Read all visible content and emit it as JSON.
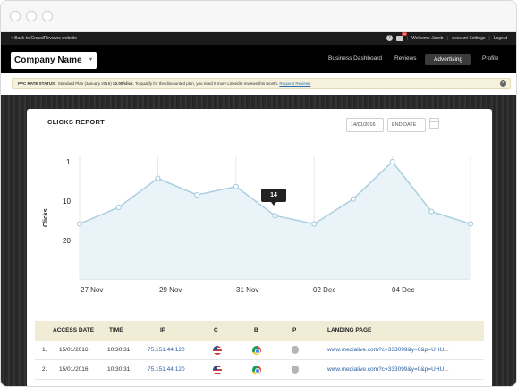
{
  "topbar": {
    "back_link": "< Back to CrowdReviews website",
    "welcome": "Welcome Jacob",
    "account_settings": "Account Settings",
    "logout": "Logout",
    "mail_badge": "10"
  },
  "header": {
    "company_name": "Company Name",
    "nav": [
      "Business Dashboard",
      "Reviews",
      "Advertising",
      "Profile"
    ],
    "active_nav": "Advertising"
  },
  "ppc_status": {
    "label": "PPC RATE STATUS",
    "text": " : Standard Plan (January 2016) ",
    "rate": "$2.00/click",
    "message": ". To qualify for the discounted plan, you need 8 more LinkedIn reviews this month. ",
    "link": "Request Reviews"
  },
  "report": {
    "title": "CLICKS REPORT",
    "start_date": "14/01/2016",
    "end_date_placeholder": "END DATE",
    "y_axis_label": "Clicks",
    "tooltip_value": "14"
  },
  "chart_data": {
    "type": "area",
    "x_tick_labels": [
      "27 Nov",
      "29 Nov",
      "31 Nov",
      "02 Dec",
      "04 Dec"
    ],
    "y_tick_labels": [
      "1",
      "10",
      "20"
    ],
    "y_inverted": true,
    "ylim": [
      1,
      20
    ],
    "values": [
      16,
      12,
      5,
      9,
      7,
      14,
      16,
      10,
      1,
      13,
      16
    ],
    "highlight_index": 5,
    "grid": "vertical",
    "colors": {
      "line": "#a9cfe0",
      "fill": "#e9f3f8",
      "point_fill": "#ffffff",
      "point_stroke": "#9cc6da"
    }
  },
  "table": {
    "columns": [
      "ACCESS DATE",
      "TIME",
      "IP",
      "C",
      "B",
      "P",
      "LANDING PAGE"
    ],
    "rows": [
      {
        "num": "1.",
        "date": "15/01/2016",
        "time": "10:30:31",
        "ip": "75.151.44.120",
        "country_icon": "us-flag-icon",
        "browser_icon": "chrome-icon",
        "platform_icon": "apple-icon",
        "landing": "www.medialive.com?c=333099&y=0&p=UHU..."
      },
      {
        "num": "2.",
        "date": "15/01/2016",
        "time": "10:30:31",
        "ip": "75.151.44.120",
        "country_icon": "us-flag-icon",
        "browser_icon": "chrome-icon",
        "platform_icon": "apple-icon",
        "landing": "www.medialive.com?c=333099&y=0&p=UHU..."
      }
    ]
  }
}
